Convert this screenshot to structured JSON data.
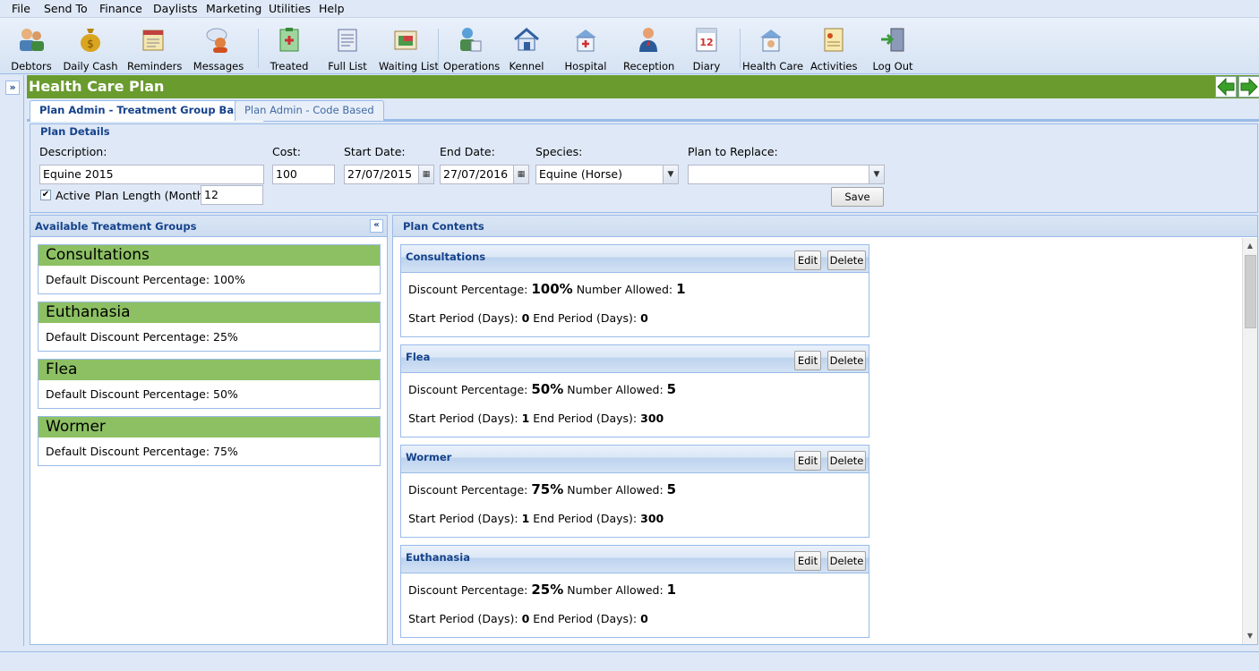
{
  "menu": [
    "File",
    "Send To",
    "Finance",
    "Daylists",
    "Marketing",
    "Utilities",
    "Help"
  ],
  "toolbar": [
    {
      "label": "Debtors",
      "icon": "debtors-icon"
    },
    {
      "label": "Daily Cash",
      "icon": "money-bag-icon"
    },
    {
      "label": "Reminders",
      "icon": "reminders-icon"
    },
    {
      "label": "Messages",
      "icon": "messages-icon"
    },
    {
      "label": "Treated",
      "icon": "treated-icon"
    },
    {
      "label": "Full List",
      "icon": "full-list-icon"
    },
    {
      "label": "Waiting List",
      "icon": "waiting-list-icon"
    },
    {
      "label": "Operations",
      "icon": "operations-icon"
    },
    {
      "label": "Kennel",
      "icon": "kennel-icon"
    },
    {
      "label": "Hospital",
      "icon": "hospital-icon"
    },
    {
      "label": "Reception",
      "icon": "reception-icon"
    },
    {
      "label": "Diary",
      "icon": "diary-icon",
      "badge": "12"
    },
    {
      "label": "Health Care",
      "icon": "health-care-icon"
    },
    {
      "label": "Activities",
      "icon": "activities-icon"
    },
    {
      "label": "Log Out",
      "icon": "log-out-icon"
    }
  ],
  "page": {
    "title": "Health Care Plan"
  },
  "tabs": {
    "active": "Plan Admin - Treatment Group Based",
    "other": "Plan Admin - Code Based"
  },
  "details": {
    "legend": "Plan Details",
    "description_label": "Description:",
    "description_value": "Equine 2015",
    "cost_label": "Cost:",
    "cost_value": "100",
    "start_label": "Start Date:",
    "start_value": "27/07/2015",
    "end_label": "End Date:",
    "end_value": "27/07/2016",
    "species_label": "Species:",
    "species_value": "Equine (Horse)",
    "replace_label": "Plan to Replace:",
    "replace_value": "",
    "active_label": "Active",
    "active_checked": true,
    "length_label": "Plan Length (Months)",
    "length_value": "12",
    "save_label": "Save"
  },
  "available": {
    "title": "Available Treatment Groups",
    "discount_label": "Default Discount Percentage:",
    "groups": [
      {
        "name": "Consultations",
        "discount": "100%"
      },
      {
        "name": "Euthanasia",
        "discount": "25%"
      },
      {
        "name": "Flea",
        "discount": "50%"
      },
      {
        "name": "Wormer",
        "discount": "75%"
      }
    ]
  },
  "contents": {
    "title": "Plan Contents",
    "edit_label": "Edit",
    "delete_label": "Delete",
    "discount_label": "Discount Percentage:",
    "allowed_label": "Number Allowed:",
    "start_label": "Start Period (Days):",
    "end_label": "End Period (Days):",
    "items": [
      {
        "name": "Consultations",
        "discount": "100%",
        "allowed": "1",
        "start": "0",
        "end": "0"
      },
      {
        "name": "Flea",
        "discount": "50%",
        "allowed": "5",
        "start": "1",
        "end": "300"
      },
      {
        "name": "Wormer",
        "discount": "75%",
        "allowed": "5",
        "start": "1",
        "end": "300"
      },
      {
        "name": "Euthanasia",
        "discount": "25%",
        "allowed": "1",
        "start": "0",
        "end": "0"
      }
    ]
  },
  "colors": {
    "title_bar": "#6a9b2f",
    "group_header": "#8dc063",
    "panel_border": "#99bbe8",
    "header_text": "#15428b"
  }
}
